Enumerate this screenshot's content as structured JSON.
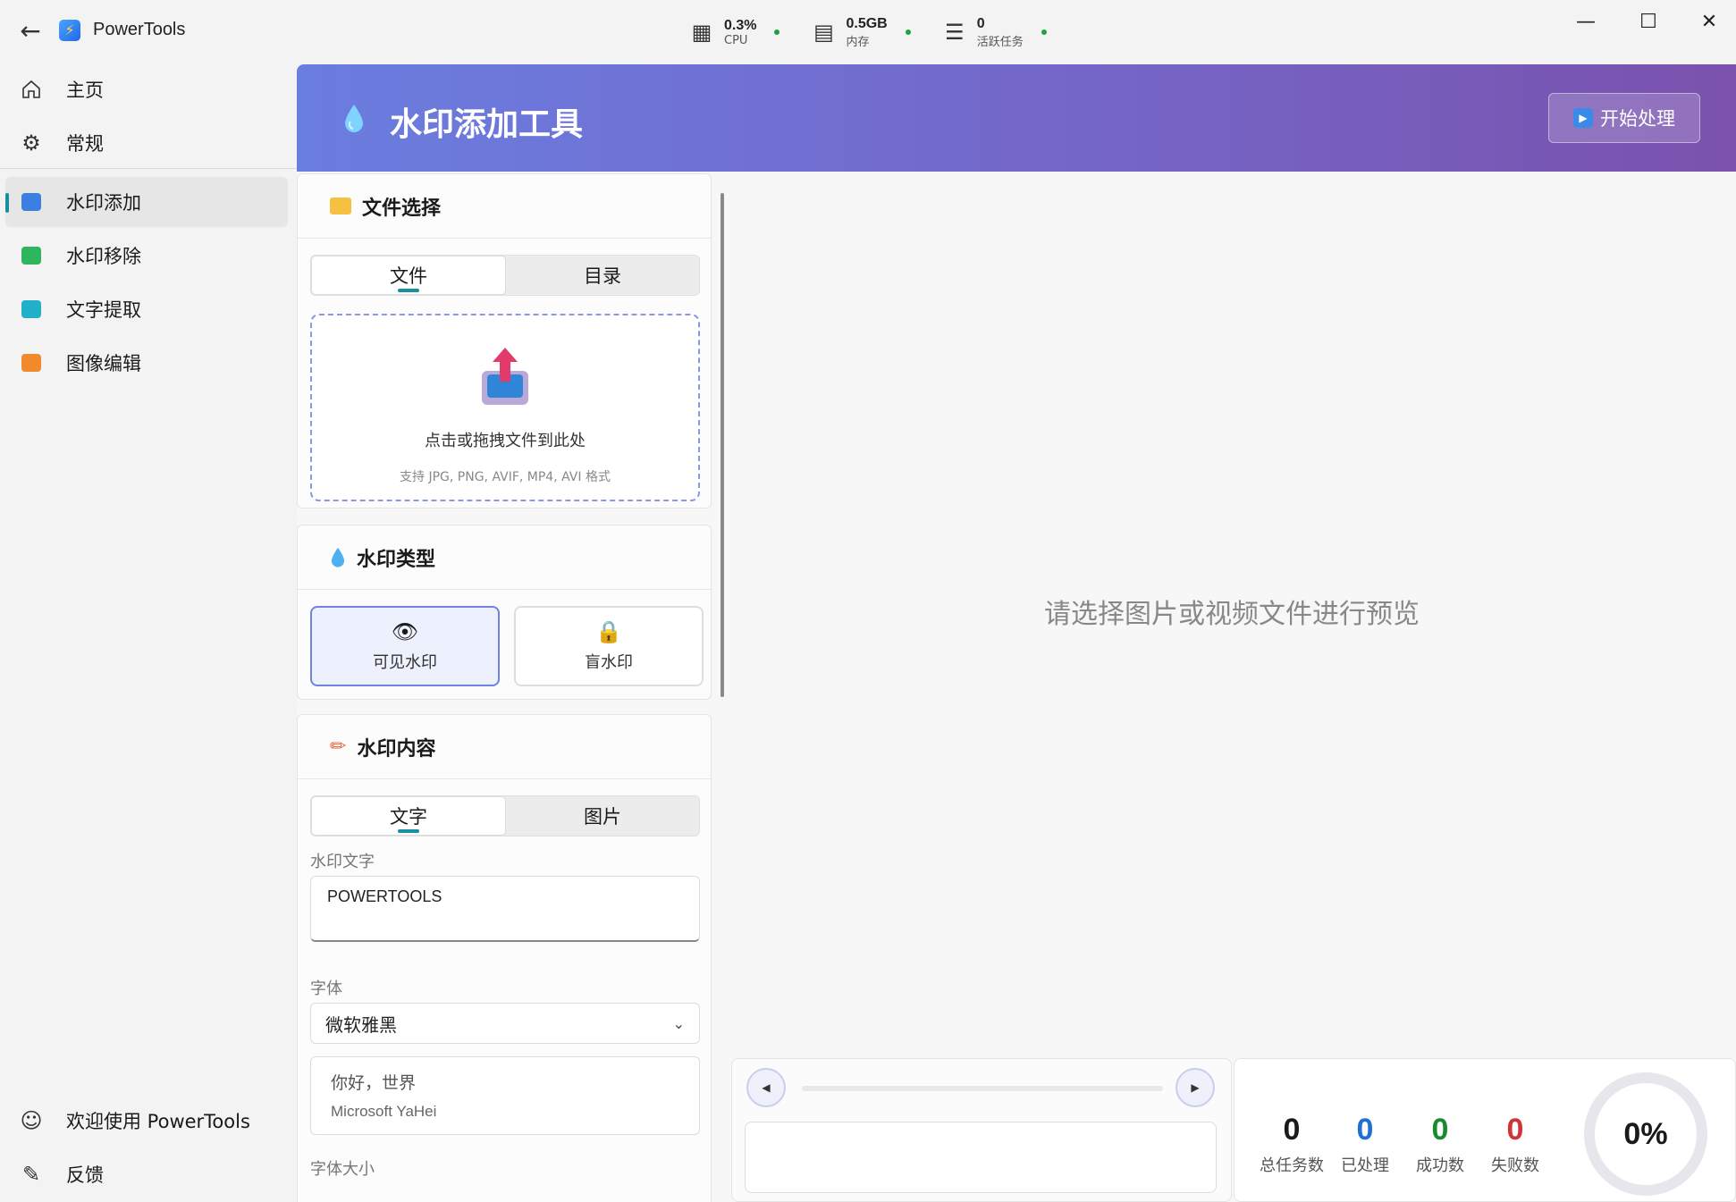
{
  "app": {
    "title": "PowerTools"
  },
  "system_stats": [
    {
      "value": "0.3%",
      "label": "CPU",
      "icon": "cpu-chip-icon",
      "status_color": "#1ba345"
    },
    {
      "value": "0.5GB",
      "label": "内存",
      "icon": "memory-icon",
      "status_color": "#1ba345"
    },
    {
      "value": "0",
      "label": "活跃任务",
      "icon": "task-list-icon",
      "status_color": "#1ba345"
    }
  ],
  "sidebar": {
    "top_items": [
      {
        "label": "主页",
        "icon": "home-icon"
      },
      {
        "label": "常规",
        "icon": "gear-icon"
      }
    ],
    "tool_items": [
      {
        "label": "水印添加",
        "icon": "watermark-add-icon",
        "active": true
      },
      {
        "label": "水印移除",
        "icon": "watermark-remove-icon",
        "active": false
      },
      {
        "label": "文字提取",
        "icon": "text-extract-icon",
        "active": false
      },
      {
        "label": "图像编辑",
        "icon": "image-edit-icon",
        "active": false
      }
    ],
    "bottom_items": [
      {
        "label": "欢迎使用 PowerTools",
        "icon": "welcome-icon"
      },
      {
        "label": "反馈",
        "icon": "feedback-icon"
      }
    ]
  },
  "header": {
    "title": "水印添加工具",
    "start_button": "开始处理",
    "gradient": [
      "#6a7ee0",
      "#7a52ad"
    ]
  },
  "file_select": {
    "title": "文件选择",
    "tabs": [
      "文件",
      "目录"
    ],
    "active_tab": "文件",
    "dropzone_text": "点击或拖拽文件到此处",
    "dropzone_hint": "支持 JPG, PNG, AVIF, MP4, AVI 格式"
  },
  "watermark_type": {
    "title": "水印类型",
    "options": [
      {
        "label": "可见水印",
        "icon": "eye-icon",
        "selected": true
      },
      {
        "label": "盲水印",
        "icon": "lock-icon",
        "selected": false
      }
    ]
  },
  "watermark_content": {
    "title": "水印内容",
    "tabs": [
      "文字",
      "图片"
    ],
    "active_tab": "文字",
    "text_label": "水印文字",
    "text_value": "POWERTOOLS",
    "font_label": "字体",
    "font_value": "微软雅黑",
    "font_preview_text": "你好，世界",
    "font_preview_name": "Microsoft YaHei",
    "size_label": "字体大小"
  },
  "preview": {
    "placeholder": "请选择图片或视频文件进行预览"
  },
  "task_stats": {
    "items": [
      {
        "value": "0",
        "label": "总任务数",
        "color": "#1a1a1a"
      },
      {
        "value": "0",
        "label": "已处理",
        "color": "#1f6fd6"
      },
      {
        "value": "0",
        "label": "成功数",
        "color": "#1a8a2e"
      },
      {
        "value": "0",
        "label": "失败数",
        "color": "#d13438"
      }
    ],
    "progress": "0%"
  }
}
